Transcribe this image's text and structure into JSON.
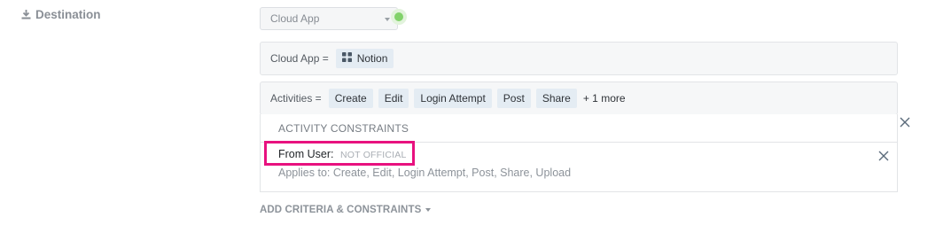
{
  "section": {
    "label": "Destination",
    "icon": "download-icon"
  },
  "destination_select": {
    "value": "Cloud App",
    "status_color": "#82d26b"
  },
  "cloud_app_row": {
    "key": "Cloud App =",
    "value": "Notion",
    "icon": "notion-grid-icon"
  },
  "activities_row": {
    "key": "Activities =",
    "chips": [
      "Create",
      "Edit",
      "Login Attempt",
      "Post",
      "Share"
    ],
    "more": "+ 1 more"
  },
  "constraints": {
    "header": "ACTIVITY CONSTRAINTS",
    "item": {
      "label": "From User:",
      "badge": "NOT OFFICIAL",
      "applies_to": "Applies to: Create, Edit, Login Attempt, Post, Share, Upload"
    }
  },
  "add_criteria": {
    "label": "ADD CRITERIA & CONSTRAINTS"
  },
  "colors": {
    "highlight": "#e8117f",
    "chip_bg": "#e4ecf3"
  }
}
